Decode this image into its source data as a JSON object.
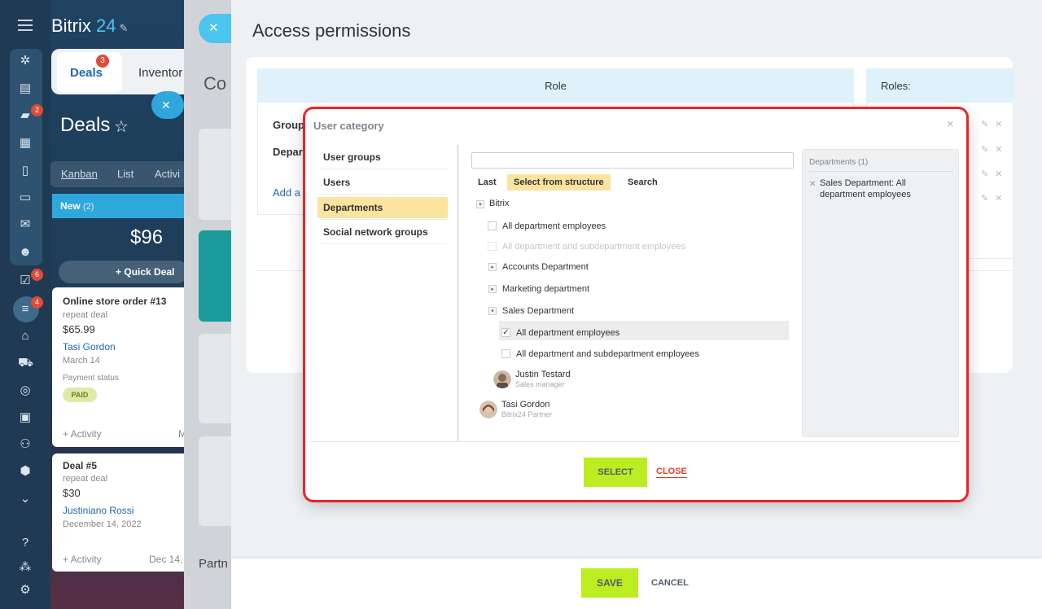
{
  "sidebar": {
    "badges": [
      "2",
      "6",
      "4"
    ],
    "icons": [
      "menu-icon",
      "crm-icon",
      "feed-icon",
      "chat-icon",
      "calendar-icon",
      "docs-icon",
      "drive-icon",
      "mail-icon",
      "groups-icon",
      "tasks-icon",
      "funnel-icon",
      "company-icon",
      "shop-icon",
      "target-icon",
      "contact-card-icon",
      "robot-icon",
      "box-icon",
      "more-icon",
      "help-icon",
      "network-icon",
      "settings-icon"
    ]
  },
  "crm": {
    "brand_name": "Bitrix",
    "brand_num": "24",
    "tab_deals": "Deals",
    "tab_deals_badge": "3",
    "tab_inventory": "Inventor",
    "title": "Deals",
    "views": [
      "Kanban",
      "List",
      "Activi"
    ],
    "column": {
      "name": "New",
      "count": "(2)",
      "total": "$96",
      "quick_deal": "Quick Deal"
    },
    "cards": [
      {
        "title": "Online store order #13",
        "sub": "repeat deal",
        "price": "$65.99",
        "contact": "Tasi Gordon",
        "date": "March 14",
        "status_label": "Payment status",
        "status": "PAID",
        "activity": "+ Activity",
        "extra": "M"
      },
      {
        "title": "Deal #5",
        "sub": "repeat deal",
        "price": "$30",
        "contact": "Justiniano Rossi",
        "date": "December 14, 2022",
        "activity": "+ Activity",
        "extra": "Dec 14,"
      }
    ]
  },
  "mid": {
    "title_frag": "Co",
    "partn": "Partn"
  },
  "access": {
    "title": "Access permissions",
    "role_col": "Role",
    "roles_col": "Roles:",
    "rows": [
      "Group",
      "Depar"
    ],
    "add_link": "Add a",
    "save": "SAVE",
    "cancel": "CANCEL"
  },
  "dialog": {
    "title": "User category",
    "close_glyph": "×",
    "categories": [
      "User groups",
      "Users",
      "Departments",
      "Social network groups"
    ],
    "selected_category": "Departments",
    "search_placeholder": "",
    "subtabs": [
      "Last",
      "Select from structure",
      "Search"
    ],
    "tree": {
      "root": "Bitrix",
      "root_all": "All department employees",
      "root_all_sub": "All department and subdepartment employees",
      "depts": [
        "Accounts Department",
        "Marketing department",
        "Sales Department"
      ],
      "sales_all": "All department employees",
      "sales_all_sub": "All department and subdepartment employees",
      "people": [
        {
          "name": "Justin Testard",
          "role": "Sales manager"
        },
        {
          "name": "Tasi Gordon",
          "role": "Bitrix24 Partner"
        }
      ]
    },
    "selected_panel": {
      "header": "Departments (1)",
      "items": [
        "Sales Department: All department employees"
      ]
    },
    "select_button": "SELECT",
    "close_link": "CLOSE"
  },
  "colors": {
    "accent_green": "#bbed21",
    "highlight_yellow": "#fbe3a0",
    "link_blue": "#2067b0",
    "danger_red": "#e23d2b",
    "callout_red": "#e8262a"
  }
}
